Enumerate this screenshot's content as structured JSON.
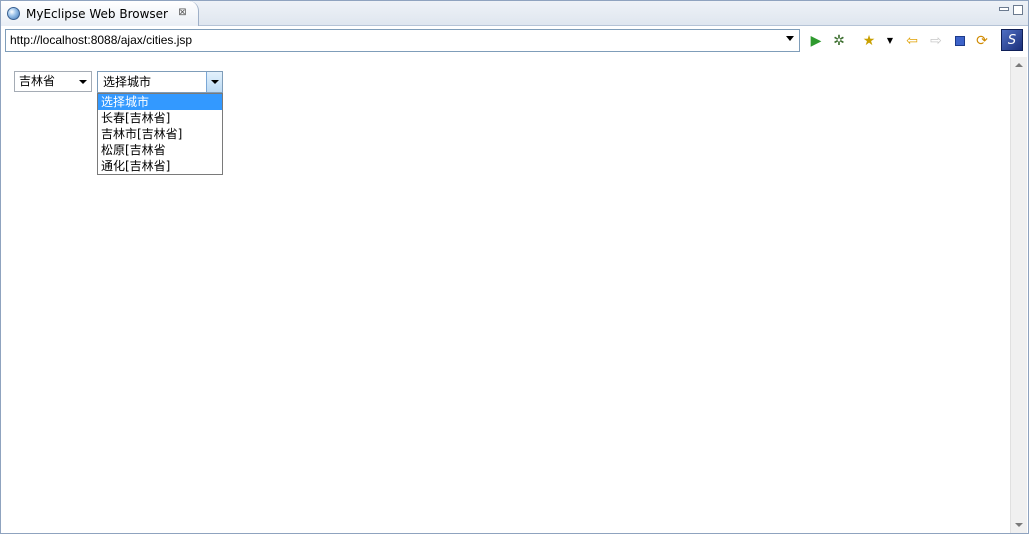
{
  "tab": {
    "title": "MyEclipse Web Browser",
    "close": "⊠"
  },
  "url": {
    "value": "http://localhost:8088/ajax/cities.jsp"
  },
  "toolbar": {
    "run_icon": "▶",
    "debug_icon": "✲",
    "favorites_icon": "★",
    "favorites_drop": "▼",
    "back_icon": "⇦",
    "forward_icon": "⇨",
    "refresh_icon": "⟳",
    "logo_text": "S"
  },
  "page": {
    "province_select": {
      "value": "吉林省"
    },
    "city_select": {
      "value": "选择城市",
      "options": [
        "选择城市",
        "长春[吉林省]",
        "吉林市[吉林省]",
        "松原[吉林省",
        "通化[吉林省]"
      ]
    }
  },
  "colors": {
    "selection": "#3399ff",
    "border": "#7f9db9"
  }
}
